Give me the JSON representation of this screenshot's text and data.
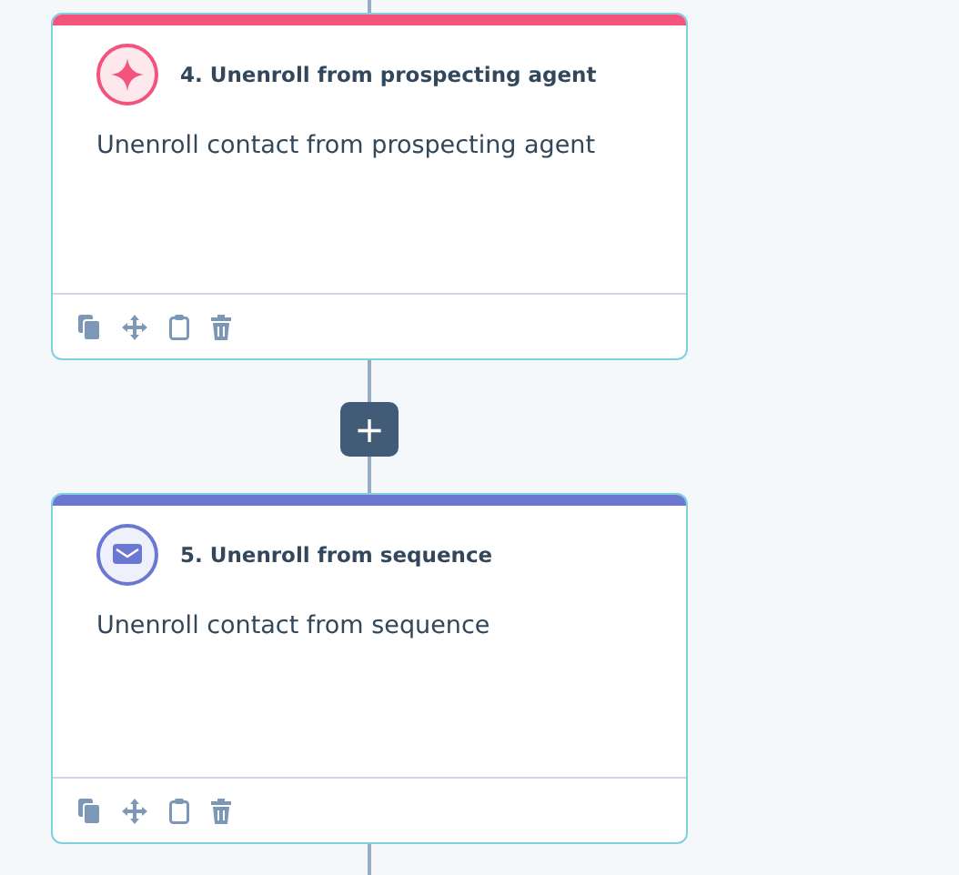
{
  "actions": [
    {
      "kind": "agent",
      "color": "#f2547d",
      "title": "4. Unenroll from prospecting agent",
      "description": "Unenroll contact from prospecting agent"
    },
    {
      "kind": "sequence",
      "color": "#6a78d1",
      "title": "5. Unenroll from sequence",
      "description": "Unenroll contact from sequence"
    }
  ],
  "add_button": "+"
}
